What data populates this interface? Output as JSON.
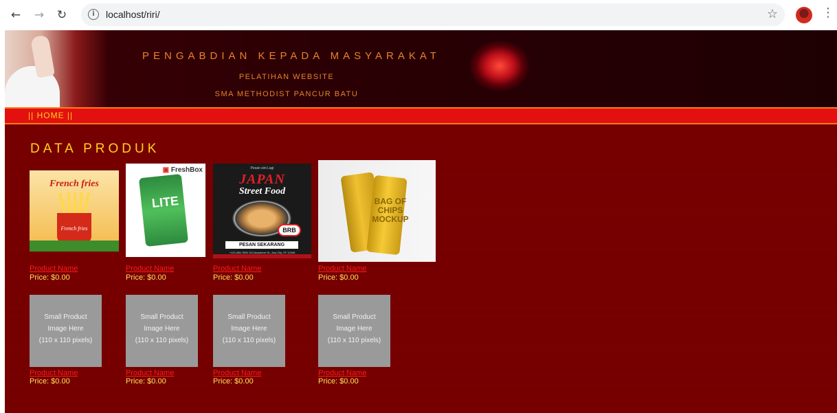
{
  "browser": {
    "url": "localhost/riri/"
  },
  "banner": {
    "title": "PENGABDIAN KEPADA MASYARAKAT",
    "subtitle1": "PELATIHAN WEBSITE",
    "subtitle2": "SMA METHODIST PANCUR BATU"
  },
  "menu": {
    "home": "|| HOME ||"
  },
  "section_title": "DATA PRODUK",
  "products_row1": [
    {
      "name": "Product Name",
      "price": "Price: $0.00",
      "image": {
        "title": "French fries",
        "label": "French fries"
      }
    },
    {
      "name": "Product Name",
      "price": "Price: $0.00",
      "image": {
        "brand": "FreshBox",
        "text": "LITE"
      }
    },
    {
      "name": "Product Name",
      "price": "Price: $0.00",
      "image": {
        "top": "Pesan sini Lagi",
        "title": "JAPAN",
        "subtitle": "Street Food",
        "badge": "BRB",
        "button": "PESAN SEKARANG",
        "footer": "+123-456-7890 123 Anywhere St., Any City, ST 12345"
      }
    },
    {
      "name": "Product Name",
      "price": "Price: $0.00",
      "image": {
        "text": "BAG OF CHIPS MOCKUP"
      }
    }
  ],
  "products_row2": [
    {
      "name": "Product Name",
      "price": "Price: $0.00",
      "placeholder": [
        "Small Product",
        "Image Here",
        "(110 x 110 pixels)"
      ]
    },
    {
      "name": "Product Name",
      "price": "Price: $0.00",
      "placeholder": [
        "Small Product",
        "Image Here",
        "(110 x 110 pixels)"
      ]
    },
    {
      "name": "Product Name",
      "price": "Price: $0.00",
      "placeholder": [
        "Small Product",
        "Image Here",
        "(110 x 110 pixels)"
      ]
    },
    {
      "name": "Product Name",
      "price": "Price: $0.00",
      "placeholder": [
        "Small Product",
        "Image Here",
        "(110 x 110 pixels)"
      ]
    }
  ],
  "colors": {
    "page_bg": "#7a0000",
    "menu_bg": "#e31010",
    "accent_yellow": "#ffd21a",
    "banner_text": "#e8822a",
    "product_name": "#ff1a1a"
  }
}
